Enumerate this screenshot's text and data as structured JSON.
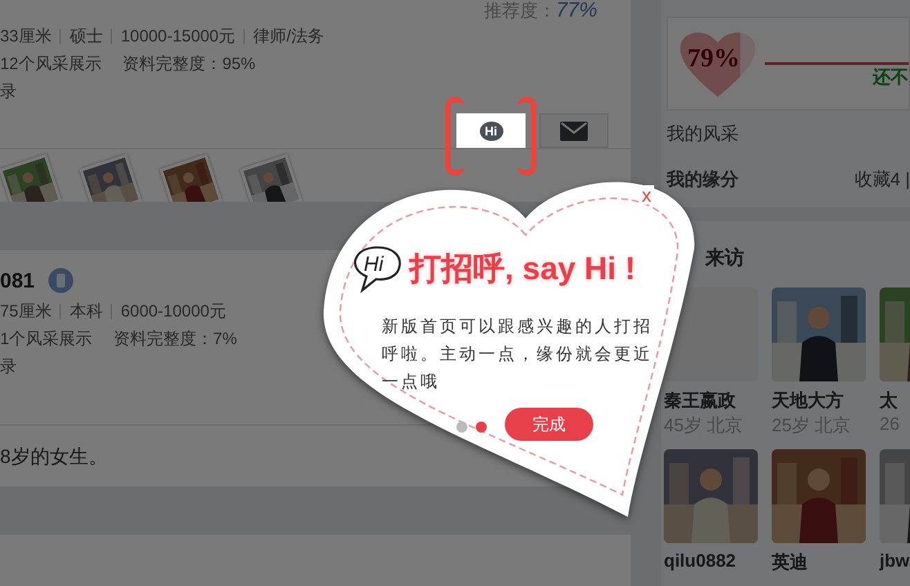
{
  "profile_card": {
    "recommend_label": "推荐度：",
    "recommend_value": "77%",
    "details": [
      "33厘米",
      "硕士",
      "10000-15000元",
      "律师/法务"
    ],
    "photos_count": "12个风采展示",
    "completeness": "资料完整度：95%",
    "line_3": "录",
    "actions": [
      {
        "kind": "hi",
        "label": "Hi",
        "highlighted": true
      },
      {
        "kind": "mail",
        "highlighted": false
      }
    ]
  },
  "profile_card_2": {
    "name": "081",
    "details": [
      "75厘米",
      "本科",
      "6000-10000元"
    ],
    "photos_count": "1个风采展示",
    "completeness": "资料完整度：7%",
    "line_3": "录",
    "intro": "8岁的女生。"
  },
  "sidebar": {
    "match": {
      "percent": "79%",
      "level": 0.79,
      "note": "还不"
    },
    "rows": [
      {
        "label": "我的风采"
      },
      {
        "label": "我的缘分",
        "value": "收藏4 |"
      }
    ],
    "visitors_title": "来访",
    "visitors": [
      {
        "kind": "placeholder",
        "name": "秦王嬴政",
        "info": "45岁 北京"
      },
      {
        "kind": "picture",
        "name": "天地大方",
        "info": "25岁 北京"
      },
      {
        "kind": "picture",
        "name": "太",
        "info": "26"
      },
      {
        "kind": "picture",
        "name": "qilu0882"
      },
      {
        "kind": "picture",
        "name": "英迪"
      },
      {
        "kind": "picture",
        "name": "jbw"
      }
    ]
  },
  "tour": {
    "close": "x",
    "icon_text": "Hi",
    "title": "打招呼, say Hi !",
    "body": "新版首页可以跟感兴趣的人打招呼啦。主动一点，缘份就会更近一点哦",
    "steps": [
      {
        "selected": false
      },
      {
        "selected": true
      }
    ],
    "done_button": "完成"
  }
}
